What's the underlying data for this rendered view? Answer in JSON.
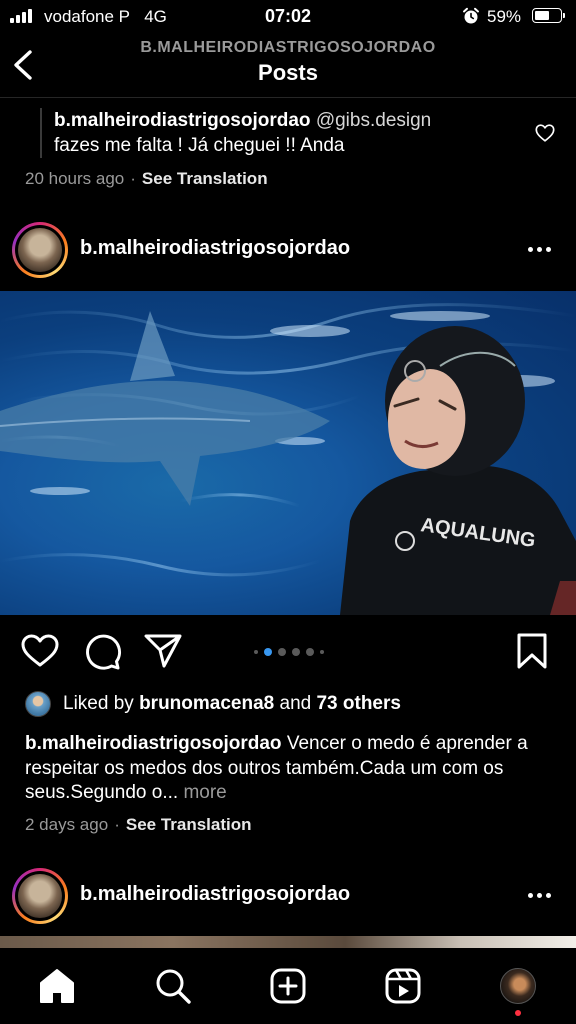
{
  "status_bar": {
    "carrier": "vodafone P",
    "network": "4G",
    "time": "07:02",
    "battery_percent": "59%",
    "battery_level": 0.59,
    "alarm_icon": "alarm-clock-icon"
  },
  "header": {
    "subtitle": "B.MALHEIRODIASTRIGOSOJORDAO",
    "title": "Posts",
    "back_icon": "chevron-left-icon"
  },
  "comment": {
    "username": "b.malheirodiastrigosojordao",
    "mention": "@gibs.design",
    "text": "fazes me falta ! Já cheguei !! Anda",
    "time": "20 hours ago",
    "separator": "·",
    "translate": "See Translation",
    "like_icon": "heart-outline-icon"
  },
  "post1": {
    "username": "b.malheirodiastrigosojordao",
    "more_icon": "ellipsis-icon",
    "image_brand_text": "AQUALUNG",
    "carousel": {
      "count": 6,
      "active_index": 1
    },
    "actions": {
      "like_icon": "heart-outline-icon",
      "comment_icon": "comment-bubble-icon",
      "share_icon": "paper-plane-icon",
      "save_icon": "bookmark-outline-icon"
    },
    "likes": {
      "prefix": "Liked by",
      "user": "brunomacena8",
      "conjunction": "and",
      "others": "73 others"
    },
    "caption": {
      "username": "b.malheirodiastrigosojordao",
      "text": "Vencer o medo é aprender a respeitar os medos dos outros também.Cada um com os seus.Segundo o...",
      "more": "more"
    },
    "time": "2 days ago",
    "separator": "·",
    "translate": "See Translation"
  },
  "post2": {
    "username": "b.malheirodiastrigosojordao",
    "more_icon": "ellipsis-icon"
  },
  "bottom_nav": {
    "home_icon": "home-icon",
    "search_icon": "search-icon",
    "create_icon": "plus-square-icon",
    "reels_icon": "reels-icon",
    "profile_icon": "profile-avatar"
  },
  "colors": {
    "background": "#000000",
    "secondary_text": "#9a9a9a",
    "active_dot": "#3897f0",
    "notification": "#ff3040"
  }
}
